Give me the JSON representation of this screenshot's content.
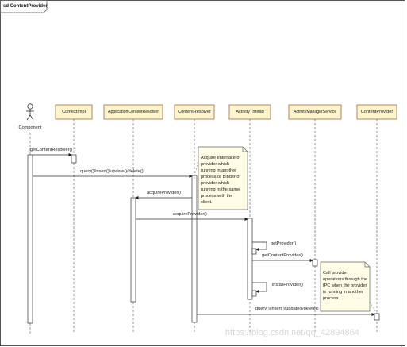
{
  "diagram": {
    "title": "sd ContentProvider",
    "participants": [
      {
        "id": "component",
        "label": "Component",
        "kind": "actor"
      },
      {
        "id": "contextimpl",
        "label": "ContextImpl",
        "kind": "object"
      },
      {
        "id": "appresolver",
        "label": "ApplicationContentResolver",
        "kind": "object"
      },
      {
        "id": "resolver",
        "label": "ContentResolver",
        "kind": "object"
      },
      {
        "id": "activitythread",
        "label": "ActivityThread",
        "kind": "object"
      },
      {
        "id": "ams",
        "label": "ActivityManagerService",
        "kind": "object"
      },
      {
        "id": "provider",
        "label": "ContentProvider",
        "kind": "object"
      }
    ],
    "messages": [
      {
        "label": "getContentResolver()"
      },
      {
        "label": "query()/insert()/update()/delete()"
      },
      {
        "label": "acquireProvider()"
      },
      {
        "label": "acquireProvider()"
      },
      {
        "label": "getProvider()"
      },
      {
        "label": "getContentProvider()"
      },
      {
        "label": "installProvider()"
      },
      {
        "label": "query()/insert()/update()/delete()"
      }
    ],
    "notes": [
      {
        "text": "Acquire IInterface of provider which running in another process or Binder of provider which running in the same process with the client."
      },
      {
        "text": "Call provider operations through the IPC when the provider is running in another process."
      }
    ],
    "watermark": "https://blog.csdn.net/qq_42894864"
  },
  "colors": {
    "participant_fill": "#fff4cc",
    "participant_stroke": "#9a6b3a",
    "note_fill": "#fffde6",
    "line": "#333333"
  }
}
